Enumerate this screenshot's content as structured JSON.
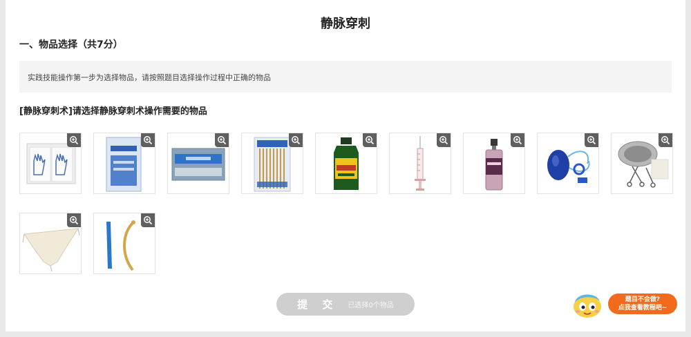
{
  "page": {
    "title": "静脉穿刺",
    "section_heading": "一、物品选择（共7分）",
    "instruction": "实践技能操作第一步为选择物品，请按照题目选择操作过程中正确的物品",
    "question": "[静脉穿刺术]请选择静脉穿刺术操作需要的物品"
  },
  "items": [
    {
      "icon": "gloves-package"
    },
    {
      "icon": "sterile-pack-blue"
    },
    {
      "icon": "bandage-roll"
    },
    {
      "icon": "cotton-swabs"
    },
    {
      "icon": "disinfectant-bottle"
    },
    {
      "icon": "syringe"
    },
    {
      "icon": "spray-bottle"
    },
    {
      "icon": "oxygen-bag"
    },
    {
      "icon": "instrument-tray"
    },
    {
      "icon": "cloth"
    },
    {
      "icon": "catheter-tube"
    }
  ],
  "submit": {
    "label": "提 交",
    "count_text": "已选择0个物品"
  },
  "helper": {
    "line1": "题目不会做?",
    "line2": "点我查看教程吧~"
  },
  "colors": {
    "submit_bg": "#cfcfcf",
    "helper_bg": "#f26b1d",
    "zoom_bg": "#5f5f5f"
  }
}
